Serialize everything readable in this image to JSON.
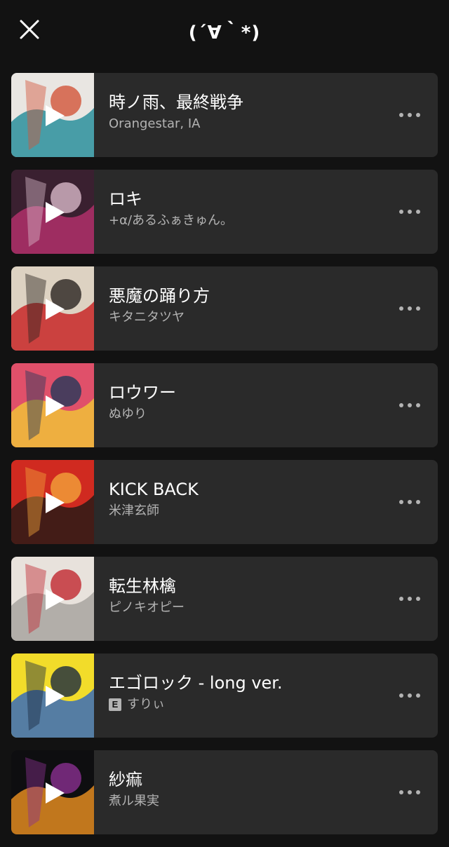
{
  "header": {
    "title": "(´∀｀*)"
  },
  "tracks": [
    {
      "title": "時ノ雨、最終戦争",
      "artist": "Orangestar, IA",
      "explicit": false,
      "art_colors": [
        "#e9e6e2",
        "#2c8f9c",
        "#d2553a"
      ]
    },
    {
      "title": "ロキ",
      "artist": "+α/あるふぁきゅん。",
      "explicit": false,
      "art_colors": [
        "#3a2030",
        "#b0306a",
        "#d8b8c8"
      ]
    },
    {
      "title": "悪魔の踊り方",
      "artist": "キタニタツヤ",
      "explicit": false,
      "art_colors": [
        "#ddd2c2",
        "#c82828",
        "#2a2420"
      ]
    },
    {
      "title": "ロウワー",
      "artist": "ぬゆり",
      "explicit": false,
      "art_colors": [
        "#e0506a",
        "#f0c038",
        "#24385a"
      ]
    },
    {
      "title": "KICK BACK",
      "artist": "米津玄師",
      "explicit": false,
      "art_colors": [
        "#d02a20",
        "#2a1a16",
        "#f2a23a"
      ]
    },
    {
      "title": "転生林檎",
      "artist": "ピノキオピー",
      "explicit": false,
      "art_colors": [
        "#e8e2dc",
        "#a8a4a0",
        "#c02830"
      ]
    },
    {
      "title": "エゴロック - long ver.",
      "artist": "すりぃ",
      "explicit": true,
      "explicit_label": "E",
      "art_colors": [
        "#f2dc2a",
        "#3a6cb8",
        "#1a2a40"
      ]
    },
    {
      "title": "紗痲",
      "artist": "煮ル果実",
      "explicit": false,
      "art_colors": [
        "#0e0e10",
        "#e08a20",
        "#8a3090"
      ]
    }
  ],
  "icons": {
    "close": "close-icon",
    "play": "play-icon",
    "more": "more-options-icon"
  }
}
